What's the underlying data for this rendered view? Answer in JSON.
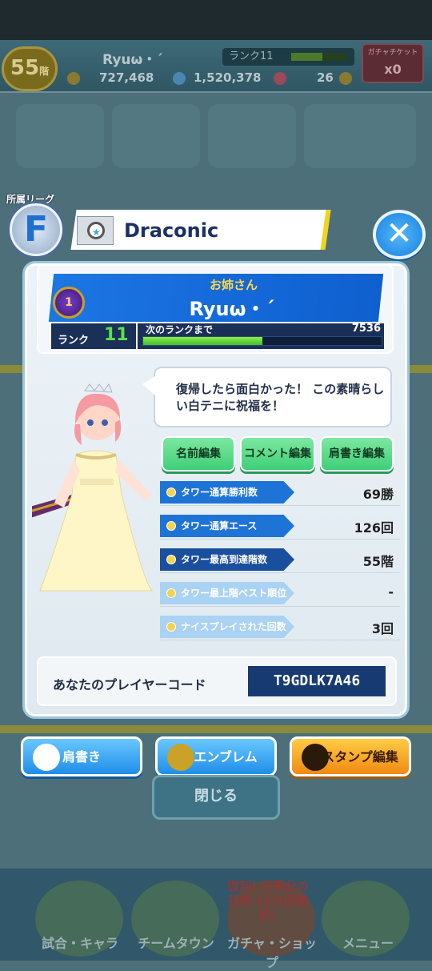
{
  "hud": {
    "floor": "55",
    "floor_unit": "階",
    "player_name": "Ryuω・´",
    "rank_label": "ランク11",
    "coins": "727,468",
    "gems": "1,520,378",
    "hearts": "26",
    "gacha_ticket_label": "ガチャチケット",
    "gacha_ticket_count": "x0"
  },
  "profile": {
    "league_label": "所属リーグ",
    "league": "F",
    "team_name": "Draconic",
    "emblem_rank": "1",
    "title": "お姉さん",
    "player_name": "Ryuω・´",
    "rank_label": "ランク",
    "rank_value": "11",
    "next_rank_label": "次のランクまで",
    "next_rank_value": "7536",
    "exp_progress": 0.5,
    "comment": "復帰したら面白かった！ この素晴らしい白テニに祝福を！",
    "edit_buttons": [
      "名前編集",
      "コメント編集",
      "肩書き編集"
    ],
    "stats": [
      {
        "label": "タワー通算勝利数",
        "value": "69勝"
      },
      {
        "label": "タワー通算エース",
        "value": "126回"
      },
      {
        "label": "タワー最高到達階数",
        "value": "55階"
      },
      {
        "label": "タワー最上階ベスト順位",
        "value": "-"
      },
      {
        "label": "ナイスプレイされた回数",
        "value": "3回"
      }
    ],
    "player_code_label": "あなたのプレイヤーコード",
    "player_code": "T9GDLK7A46"
  },
  "actions": {
    "title_btn": "肩書き",
    "emblem_btn": "エンブレム",
    "stamp_btn": "スタンプ編集",
    "close_btn": "閉じる"
  },
  "nav": {
    "items": [
      "試合・キャラ",
      "チームタウン",
      "ガチャ・ショップ",
      "メニュー"
    ],
    "promo": "復刻! 五等分の花嫁 1日1回無料!"
  },
  "colors": {
    "accent": "#1b76e3",
    "green": "#3fcf78",
    "orange": "#f08a12"
  }
}
